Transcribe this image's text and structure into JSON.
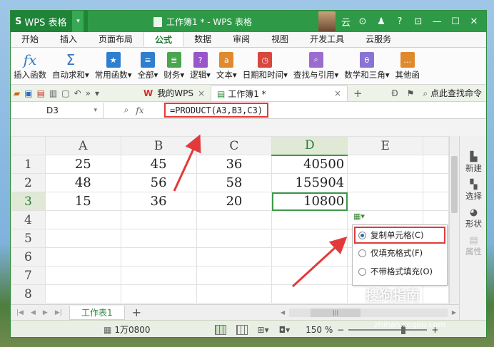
{
  "titlebar": {
    "app_name": "WPS 表格",
    "doc_title": "工作簿1 * - WPS 表格",
    "user_name": "云",
    "controls": [
      "⊙",
      "♟",
      "?",
      "⊡",
      "—",
      "☐",
      "✕"
    ]
  },
  "menu_tabs": [
    {
      "label": "开始",
      "active": false
    },
    {
      "label": "插入",
      "active": false
    },
    {
      "label": "页面布局",
      "active": false
    },
    {
      "label": "公式",
      "active": true
    },
    {
      "label": "数据",
      "active": false
    },
    {
      "label": "审阅",
      "active": false
    },
    {
      "label": "视图",
      "active": false
    },
    {
      "label": "开发工具",
      "active": false
    },
    {
      "label": "云服务",
      "active": false
    }
  ],
  "ribbon": [
    {
      "label": "插入函数",
      "icon": "fx-icon"
    },
    {
      "label": "自动求和▾",
      "icon": "sigma-icon"
    },
    {
      "label": "常用函数▾",
      "icon": "star-box-icon"
    },
    {
      "label": "全部▾",
      "icon": "list-box-icon"
    },
    {
      "label": "财务▾",
      "icon": "finance-box-icon"
    },
    {
      "label": "逻辑▾",
      "icon": "question-box-icon"
    },
    {
      "label": "文本▾",
      "icon": "text-box-icon"
    },
    {
      "label": "日期和时间▾",
      "icon": "clock-box-icon"
    },
    {
      "label": "查找与引用▾",
      "icon": "search-box-icon"
    },
    {
      "label": "数学和三角▾",
      "icon": "theta-box-icon"
    },
    {
      "label": "其他函",
      "icon": "more-box-icon"
    }
  ],
  "quickbar": {
    "tabs": [
      {
        "label": "我的WPS",
        "active": false
      },
      {
        "label": "工作簿1 *",
        "active": true
      }
    ],
    "search_label": "点此查找命令"
  },
  "formula_bar": {
    "name_box": "D3",
    "fx_label": "fx",
    "formula": "=PRODUCT(A3,B3,C3)"
  },
  "grid": {
    "columns": [
      "A",
      "B",
      "C",
      "D",
      "E"
    ],
    "selected_column": "D",
    "selected_row": "3",
    "rows": [
      {
        "row": "1",
        "cells": [
          "25",
          "45",
          "36",
          "40500",
          ""
        ]
      },
      {
        "row": "2",
        "cells": [
          "48",
          "56",
          "58",
          "155904",
          ""
        ]
      },
      {
        "row": "3",
        "cells": [
          "15",
          "36",
          "20",
          "10800",
          ""
        ]
      },
      {
        "row": "4",
        "cells": [
          "",
          "",
          "",
          "",
          ""
        ]
      },
      {
        "row": "5",
        "cells": [
          "",
          "",
          "",
          "",
          ""
        ]
      },
      {
        "row": "6",
        "cells": [
          "",
          "",
          "",
          "",
          ""
        ]
      },
      {
        "row": "7",
        "cells": [
          "",
          "",
          "",
          "",
          ""
        ]
      },
      {
        "row": "8",
        "cells": [
          "",
          "",
          "",
          "",
          ""
        ]
      }
    ]
  },
  "paste_options": {
    "items": [
      {
        "label": "复制单元格(C)",
        "selected": true
      },
      {
        "label": "仅填充格式(F)",
        "selected": false
      },
      {
        "label": "不带格式填充(O)",
        "selected": false
      }
    ]
  },
  "side_panel": [
    {
      "label": "新建",
      "enabled": true
    },
    {
      "label": "选择",
      "enabled": true
    },
    {
      "label": "形状",
      "enabled": true
    },
    {
      "label": "属性",
      "enabled": false
    }
  ],
  "sheet_bar": {
    "sheet_tab": "工作表1",
    "add_tab": "+"
  },
  "status_bar": {
    "count_text": "1万0800",
    "zoom_label": "150 %"
  },
  "watermark": {
    "text": "搜狗指南",
    "url": "zhinan.sogou.com"
  },
  "colors": {
    "title_green": "#2e9a47",
    "selection_green": "#3c9a4b",
    "annotation_red": "#e23a3a"
  }
}
